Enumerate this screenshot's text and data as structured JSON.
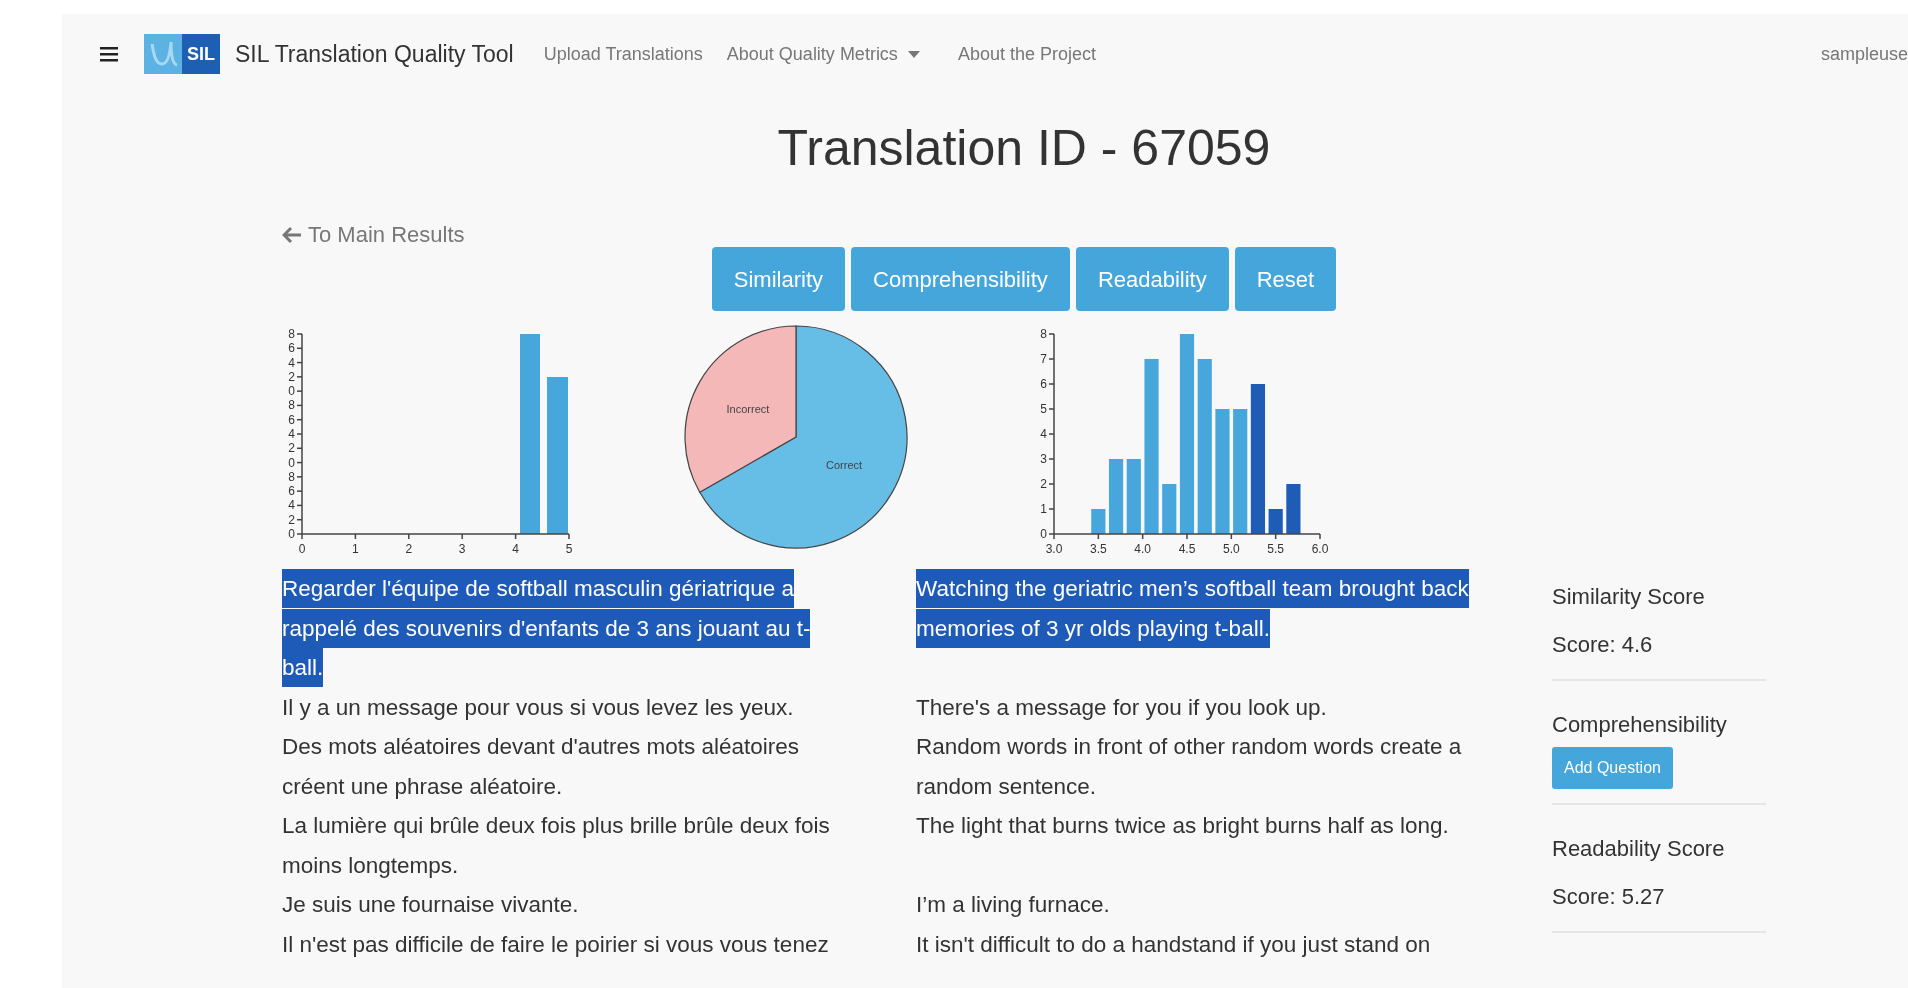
{
  "navbar": {
    "logo_text": "SIL",
    "brand": "SIL Translation Quality Tool",
    "links": [
      {
        "label": "Upload Translations",
        "dropdown": false
      },
      {
        "label": "About Quality Metrics",
        "dropdown": true
      },
      {
        "label": "About the Project",
        "dropdown": false
      }
    ],
    "user": "sampleuse"
  },
  "title": "Translation ID - 67059",
  "back_link": "To Main Results",
  "buttons": [
    "Similarity",
    "Comprehensibility",
    "Readability",
    "Reset"
  ],
  "charts": [
    {
      "kind": "histogram_picture",
      "x_axis_labels": [
        "0",
        "1",
        "2",
        "3",
        "4",
        "5"
      ],
      "y_axis_labels": [
        "8",
        "6",
        "4",
        "2",
        "0",
        "8",
        "6",
        "4",
        "2",
        "0",
        "8",
        "6",
        "4",
        "2",
        "0"
      ]
    },
    {
      "chart_data": {
        "type": "pie",
        "categories": [
          "Correct",
          "Incorrect"
        ],
        "series": [
          {
            "values": [
              66.7,
              33.3
            ],
            "colors": [
              "#66bde6",
              "#f4b8b8"
            ]
          }
        ]
      }
    },
    {
      "chart_data": {
        "type": "bar",
        "x": [
          3.5,
          3.7,
          3.9,
          4.1,
          4.3,
          4.5,
          4.7,
          4.9,
          5.1,
          5.3,
          5.5,
          5.7
        ],
        "xlim": [
          3.0,
          6.0
        ],
        "ylim": [
          0,
          8
        ],
        "xticks": [
          {
            "value": 3,
            "label": "3.0"
          },
          {
            "value": 3.5,
            "label": "3.5"
          },
          {
            "value": 4,
            "label": "4.0"
          },
          {
            "value": 4.5,
            "label": "4.5"
          },
          {
            "value": 5,
            "label": "5.0"
          },
          {
            "value": 5.5,
            "label": "5.5"
          },
          {
            "value": 6,
            "label": "6.0"
          }
        ],
        "yticks": [
          0,
          1,
          2,
          3,
          4,
          5,
          6,
          7,
          8
        ],
        "series": [
          {
            "color": "#47a6dc",
            "values": [
              1,
              3,
              3,
              7,
              2,
              8,
              7,
              5,
              5,
              null,
              null,
              null
            ]
          },
          {
            "color": "#1e5cb5",
            "values": [
              null,
              null,
              null,
              null,
              null,
              null,
              null,
              null,
              null,
              6,
              1,
              2
            ]
          }
        ]
      }
    }
  ],
  "sentences": [
    {
      "source": "Regarder l'équipe de softball masculin gériatrique a rappelé des souvenirs d'enfants de 3 ans jouant au t-ball.",
      "target": "Watching the geriatric men’s softball team brought back memories of 3 yr olds playing t-ball.",
      "selected": true
    },
    {
      "source": "Il y a un message pour vous si vous levez les yeux.",
      "target": "There's a message for you if you look up.",
      "selected": false
    },
    {
      "source": "Des mots aléatoires devant d'autres mots aléatoires créent une phrase aléatoire.",
      "target": "Random words in front of other random words create a random sentence.",
      "selected": false
    },
    {
      "source": "La lumière qui brûle deux fois plus brille brûle deux fois moins longtemps.",
      "target": "The light that burns twice as bright burns half as long.",
      "selected": false
    },
    {
      "source": "Je suis une fournaise vivante.",
      "target": "I’m a living furnace.",
      "selected": false
    },
    {
      "source": "Il n'est pas difficile de faire le poirier si vous vous tenez",
      "target": "It isn't difficult to do a handstand if you just stand on",
      "selected": false
    }
  ],
  "sidebar": [
    {
      "kind": "score",
      "heading": "Similarity Score",
      "text": "Score: 4.6"
    },
    {
      "kind": "button",
      "heading": "Comprehensibility",
      "text": "Add Question"
    },
    {
      "kind": "score",
      "heading": "Readability Score",
      "text": "Score: 5.27"
    }
  ]
}
